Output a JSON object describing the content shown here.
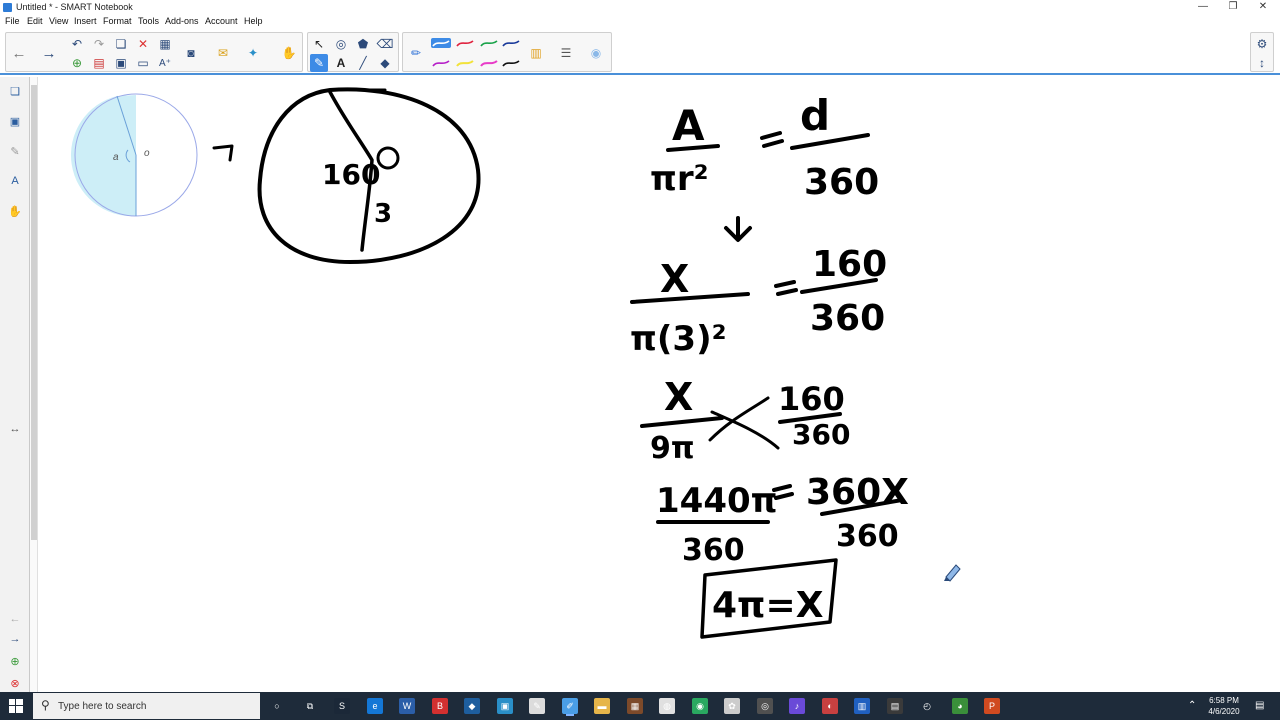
{
  "window": {
    "title": "Untitled * - SMART Notebook",
    "minimize": "—",
    "maximize": "❐",
    "close": "✕"
  },
  "menu": [
    "File",
    "Edit",
    "View",
    "Insert",
    "Format",
    "Tools",
    "Add-ons",
    "Account",
    "Help"
  ],
  "toolbar": {
    "icons": [
      "back-icon",
      "forward-icon",
      "undo-icon",
      "redo-icon",
      "insert-page-icon",
      "delete-icon",
      "table-icon",
      "screen-shade-icon",
      "document-camera-icon",
      "response-icon",
      "lesson-activity-icon",
      "select-icon",
      "shapes-icon",
      "fill-icon",
      "eraser-fill-icon",
      "pen-icon",
      "text-icon",
      "line-icon",
      "eraser-icon",
      "properties-icon",
      "settings-icon"
    ],
    "pen_colors": [
      "#1a6fd6",
      "#e0233f",
      "#1aa34a",
      "#1a3a9a",
      "#b620c8",
      "#f2e23a",
      "#e83cc8",
      "#111111"
    ]
  },
  "canvas": {
    "circle_labels": {
      "a": "a",
      "o": "o"
    },
    "arrow": "→",
    "big_circle": {
      "angle": "160",
      "radius": "3"
    },
    "eq1": {
      "A": "A",
      "pi_r2": "πr²",
      "d": "d",
      "d360": "360"
    },
    "eq2": {
      "x": "X",
      "pi32": "π(3)²",
      "n160": "160",
      "d360": "360"
    },
    "eq3": {
      "x": "X",
      "ninepi": "9π",
      "n160": "160",
      "d360": "360"
    },
    "eq4": {
      "lhs": "1440π",
      "rhs": "360X",
      "d360a": "360",
      "d360b": "360"
    },
    "answer": "4π=X"
  },
  "taskbar": {
    "search_placeholder": "Type here to search",
    "time": "6:58 PM",
    "date": "4/6/2020",
    "apps": [
      {
        "name": "cortana-icon",
        "color": "#1e2b3a",
        "glyph": "○"
      },
      {
        "name": "task-view-icon",
        "color": "#1e2b3a",
        "glyph": "⧉"
      },
      {
        "name": "steam-icon",
        "color": "#1b2838",
        "glyph": "S"
      },
      {
        "name": "edge-icon",
        "color": "#1477d6",
        "glyph": "e"
      },
      {
        "name": "word-icon",
        "color": "#2b5ea8",
        "glyph": "W"
      },
      {
        "name": "app-b-icon",
        "color": "#d23030",
        "glyph": "B"
      },
      {
        "name": "app-blue-icon",
        "color": "#1e5e9e",
        "glyph": "◆"
      },
      {
        "name": "app-cyan-icon",
        "color": "#2a8fc8",
        "glyph": "▣"
      },
      {
        "name": "app-pen-icon",
        "color": "#dcdcdc",
        "glyph": "✎"
      },
      {
        "name": "smart-notebook-icon",
        "color": "#4a9ee6",
        "glyph": "✐"
      },
      {
        "name": "folder-icon",
        "color": "#e6b54a",
        "glyph": "▬"
      },
      {
        "name": "app-grid-icon",
        "color": "#7d4a2a",
        "glyph": "▦"
      },
      {
        "name": "app-cup-icon",
        "color": "#e0e0e0",
        "glyph": "◍"
      },
      {
        "name": "app-green-icon",
        "color": "#2aa860",
        "glyph": "◉"
      },
      {
        "name": "app-flower-icon",
        "color": "#cccccc",
        "glyph": "✿"
      },
      {
        "name": "app-record-icon",
        "color": "#505050",
        "glyph": "◎"
      },
      {
        "name": "app-music-icon",
        "color": "#6a4ad8",
        "glyph": "♪"
      },
      {
        "name": "app-red-icon",
        "color": "#c84040",
        "glyph": "◐"
      },
      {
        "name": "app-blue2-icon",
        "color": "#2060c0",
        "glyph": "▥"
      },
      {
        "name": "app-slides-icon",
        "color": "#3a3a3a",
        "glyph": "▤"
      },
      {
        "name": "app-clock-icon",
        "color": "#1e2b3a",
        "glyph": "◴"
      },
      {
        "name": "chrome-icon",
        "color": "#3a8f3a",
        "glyph": "◕"
      },
      {
        "name": "powerpoint-icon",
        "color": "#d04a20",
        "glyph": "P"
      }
    ]
  }
}
